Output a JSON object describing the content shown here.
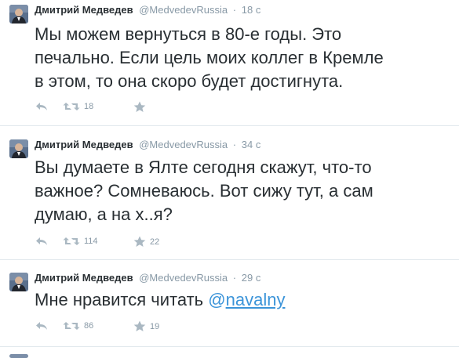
{
  "tweets": [
    {
      "name": "Дмитрий Медведев",
      "handle": "@MedvedevRussia",
      "sep": "·",
      "time": "18 с",
      "text_lines": [
        "Мы можем вернуться в 80-е годы. Это",
        "печально. Если цель моих коллег в Кремле",
        "в этом, то она скоро будет достигнута."
      ],
      "retweets": "18",
      "favorites": ""
    },
    {
      "name": "Дмитрий Медведев",
      "handle": "@MedvedevRussia",
      "sep": "·",
      "time": "34 с",
      "text_lines": [
        "Вы думаете в Ялте сегодня скажут, что-то",
        "важное? Сомневаюсь. Вот сижу тут, а сам",
        "думаю, а на х..я?"
      ],
      "retweets": "114",
      "favorites": "22"
    },
    {
      "name": "Дмитрий Медведев",
      "handle": "@MedvedevRussia",
      "sep": "·",
      "time": "29 с",
      "text_prefix": "Мне нравится читать ",
      "mention_at": "@",
      "mention_user": "navalny",
      "retweets": "86",
      "favorites": "19"
    }
  ],
  "icons": {
    "reply": "reply-icon",
    "retweet": "retweet-icon",
    "favorite": "star-icon",
    "avatar": "avatar-portrait"
  },
  "colors": {
    "text": "#292f33",
    "meta": "#8899a6",
    "icon": "#aab8c2",
    "link": "#3b94d9",
    "divider": "#e1e8ed"
  }
}
